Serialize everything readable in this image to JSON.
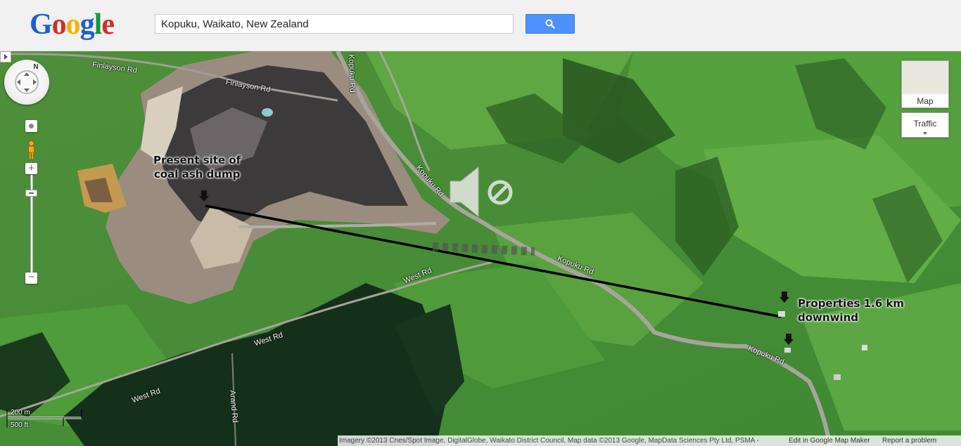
{
  "header": {
    "logo_letters": [
      {
        "char": "G",
        "color": "#1a5fd3"
      },
      {
        "char": "o",
        "color": "#d62d20"
      },
      {
        "char": "o",
        "color": "#f0b400"
      },
      {
        "char": "g",
        "color": "#1a5fd3"
      },
      {
        "char": "l",
        "color": "#109a38"
      },
      {
        "char": "e",
        "color": "#d62d20"
      }
    ],
    "search_value": "Kopuku, Waikato, New Zealand",
    "search_icon": "magnifier-icon"
  },
  "map": {
    "view_type": "satellite",
    "controls": {
      "north": "N",
      "pan_icon": "pan-arrows-icon",
      "rotate_icon": "rotate-icon",
      "pegman_icon": "pegman-icon",
      "zoom_in": "+",
      "zoom_out": "−",
      "zoom_level_fraction": 0.15
    },
    "map_type": {
      "label": "Map"
    },
    "traffic": {
      "label": "Traffic"
    },
    "scale": {
      "metric": "200 m",
      "imperial": "500 ft"
    },
    "road_labels": {
      "finlayson_1": "Finlayson Rd",
      "finlayson_2": "Finlayson Rd",
      "kopuku_1": "Kopuku Rd",
      "kopuku_2": "Kopuku Rd",
      "kopuku_3": "Kopuku Rd",
      "west_1": "West Rd",
      "west_2": "West Rd",
      "west_3": "West Rd",
      "arand": "Arand Rd",
      "vertical_top": "Kopuku Rd"
    },
    "annotations": {
      "site_line1": "Present site of",
      "site_line2": "coal ash dump",
      "props_line1": "Properties 1.6 km",
      "props_line2": "downwind"
    },
    "overlay_icons": [
      "speaker-icon",
      "prohibited-icon"
    ],
    "footer": {
      "attribution": "Imagery ©2013 Cnes/Spot Image, DigitalGlobe, Waikato District Council, Map data ©2013 Google, MapData Sciences Pty Ltd, PSMA -",
      "edit_link": "Edit in Google Map Maker",
      "report_link": "Report a problem"
    }
  }
}
